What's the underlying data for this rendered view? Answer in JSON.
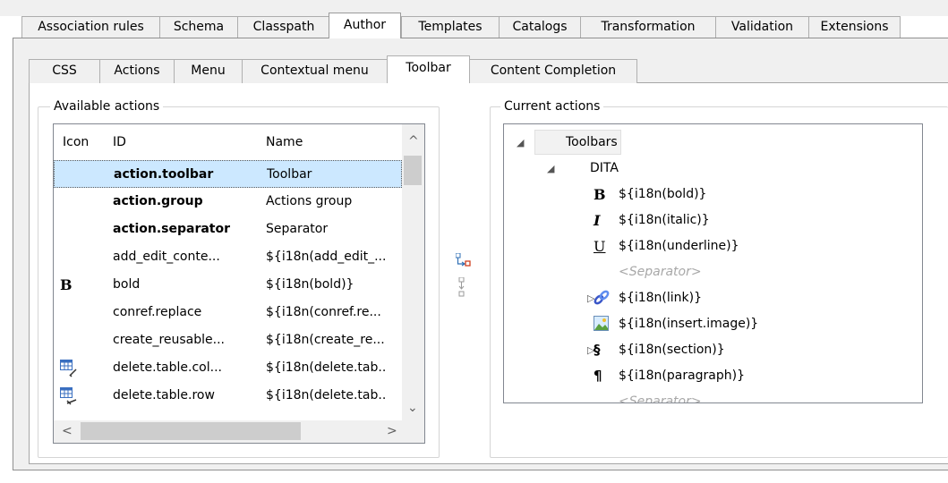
{
  "top_tabs": [
    "Association rules",
    "Schema",
    "Classpath",
    "Author",
    "Templates",
    "Catalogs",
    "Transformation",
    "Validation",
    "Extensions"
  ],
  "top_active": "Author",
  "sub_tabs": [
    "CSS",
    "Actions",
    "Menu",
    "Contextual menu",
    "Toolbar",
    "Content Completion"
  ],
  "sub_active": "Toolbar",
  "available": {
    "label": "Available actions",
    "headers": {
      "icon": "Icon",
      "id": "ID",
      "name": "Name"
    },
    "rows": [
      {
        "icon": "",
        "id": "action.toolbar",
        "name": "Toolbar",
        "bold": true,
        "selected": true
      },
      {
        "icon": "",
        "id": "action.group",
        "name": "Actions group",
        "bold": true
      },
      {
        "icon": "",
        "id": "action.separator",
        "name": "Separator",
        "bold": true
      },
      {
        "icon": "",
        "id": "add_edit_conte...",
        "name": "${i18n(add_edit_..."
      },
      {
        "icon": "bold-icon",
        "id": "bold",
        "name": "${i18n(bold)}"
      },
      {
        "icon": "",
        "id": "conref.replace",
        "name": "${i18n(conref.re..."
      },
      {
        "icon": "",
        "id": "create_reusable...",
        "name": "${i18n(create_re..."
      },
      {
        "icon": "delete-column-icon",
        "id": "delete.table.col...",
        "name": "${i18n(delete.tab.."
      },
      {
        "icon": "delete-row-icon",
        "id": "delete.table.row",
        "name": "${i18n(delete.tab.."
      },
      {
        "icon": "",
        "id": "",
        "name": ""
      }
    ]
  },
  "current": {
    "label": "Current actions",
    "nodes": [
      {
        "text": "Toolbars",
        "level": 0,
        "toggle": "expanded",
        "boxed": true
      },
      {
        "text": "DITA",
        "level": 1,
        "toggle": "expanded"
      },
      {
        "text": "${i18n(bold)}",
        "level": 2,
        "icon": "bold-icon"
      },
      {
        "text": "${i18n(italic)}",
        "level": 2,
        "icon": "italic-icon"
      },
      {
        "text": "${i18n(underline)}",
        "level": 2,
        "icon": "underline-icon"
      },
      {
        "text": "<Separator>",
        "level": 2,
        "separator": true
      },
      {
        "text": "${i18n(link)}",
        "level": 2,
        "icon": "link-icon",
        "toggle": "collapsed"
      },
      {
        "text": "${i18n(insert.image)}",
        "level": 2,
        "icon": "image-icon"
      },
      {
        "text": "${i18n(section)}",
        "level": 2,
        "icon": "section-icon",
        "toggle": "collapsed"
      },
      {
        "text": "${i18n(paragraph)}",
        "level": 2,
        "icon": "paragraph-icon"
      },
      {
        "text": "<Separator>",
        "level": 2,
        "separator": true
      }
    ]
  },
  "glyphs": {
    "bold": "B",
    "italic": "I",
    "underline": "U",
    "section": "§",
    "paragraph": "¶"
  }
}
